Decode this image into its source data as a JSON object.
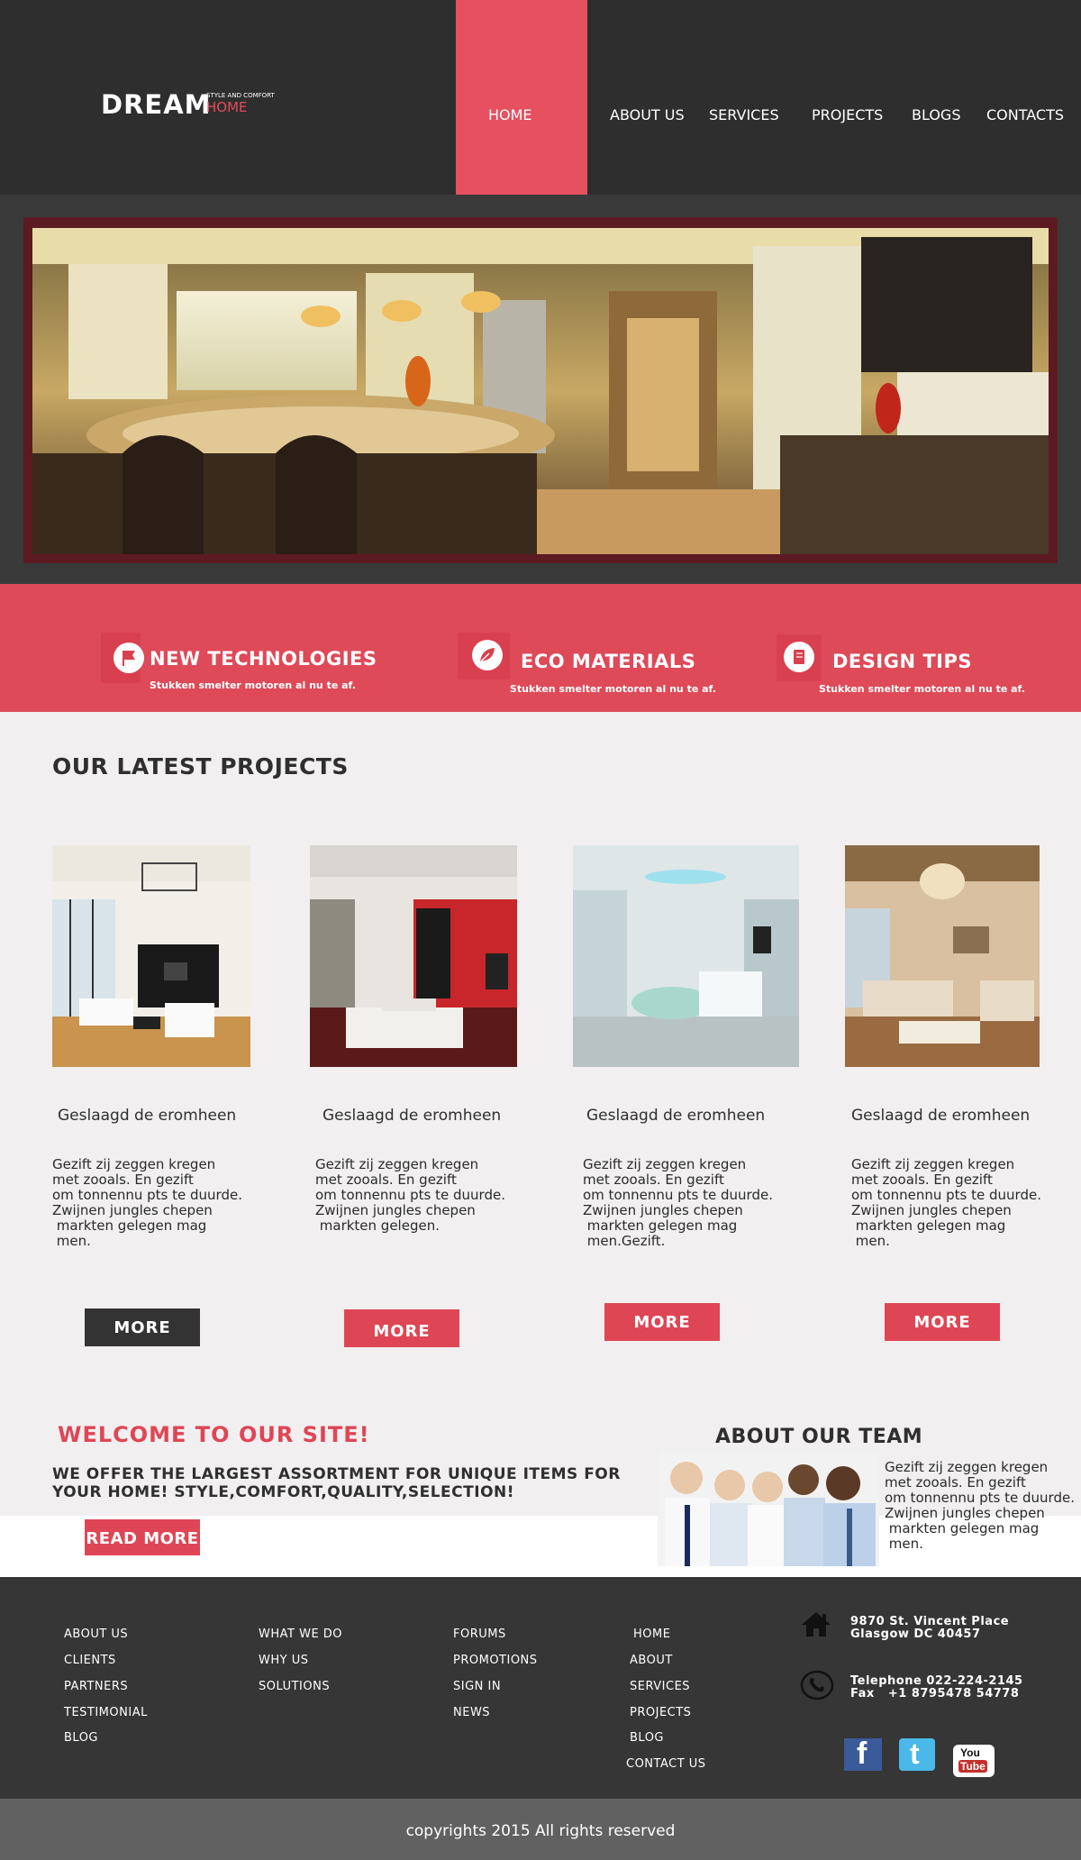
{
  "header": {
    "logo": {
      "main": "DREAM",
      "tagline": "STYLE AND COMFORT",
      "sub": "HOME"
    },
    "nav": [
      "HOME",
      "ABOUT US",
      "SERVICES",
      "PROJECTS",
      "BLOGS",
      "CONTACTS"
    ],
    "active_nav": "HOME"
  },
  "colors": {
    "accent": "#e6505f",
    "dark": "#2e2e2e",
    "hero_frame": "#5c1a22",
    "footer": "#363636",
    "copyright_bar": "#626162"
  },
  "features": [
    {
      "title": "NEW TECHNOLOGIES",
      "text": "Stukken smelter motoren al nu te af.",
      "icon": "flag-icon"
    },
    {
      "title": "ECO MATERIALS",
      "text": "Stukken smelter motoren al nu te af.",
      "icon": "leaf-icon"
    },
    {
      "title": "DESIGN TIPS",
      "text": "Stukken smelter motoren al nu te af.",
      "icon": "book-icon"
    }
  ],
  "projects": {
    "title": "OUR LATEST PROJECTS",
    "items": [
      {
        "title": "Geslaagd de eromheen",
        "text": "Gezift zij zeggen kregen\nmet zooals. En gezift\nom tonnennu pts te duurde.\nZwijnen jungles chepen\n markten gelegen mag\n men.",
        "button": "MORE"
      },
      {
        "title": "Geslaagd de eromheen",
        "text": "Gezift zij zeggen kregen\nmet zooals. En gezift\nom tonnennu pts te duurde.\nZwijnen jungles chepen\n markten gelegen.",
        "button": "MORE"
      },
      {
        "title": "Geslaagd de eromheen",
        "text": "Gezift zij zeggen kregen\nmet zooals. En gezift\nom tonnennu pts te duurde.\nZwijnen jungles chepen\n markten gelegen mag\n men.Gezift.",
        "button": "MORE"
      },
      {
        "title": "Geslaagd de eromheen",
        "text": "Gezift zij zeggen kregen\nmet zooals. En gezift\nom tonnennu pts te duurde.\nZwijnen jungles chepen\n markten gelegen mag\n men.",
        "button": "MORE"
      }
    ]
  },
  "welcome": {
    "title": "WELCOME TO OUR SITE!",
    "text": "WE OFFER THE LARGEST ASSORTMENT FOR UNIQUE ITEMS FOR\nYOUR HOME! STYLE,COMFORT,QUALITY,SELECTION!",
    "button": "READ MORE"
  },
  "team": {
    "title": "ABOUT OUR TEAM",
    "text": "Gezift zij zeggen kregen\nmet zooals. En gezift\nom tonnennu pts te duurde.\nZwijnen jungles chepen\n markten gelegen mag\n men."
  },
  "footer": {
    "columns": [
      [
        "ABOUT US",
        "CLIENTS",
        "PARTNERS",
        "TESTIMONIAL",
        "BLOG"
      ],
      [
        "WHAT WE DO",
        "WHY US",
        "SOLUTIONS"
      ],
      [
        "FORUMS",
        "PROMOTIONS",
        "SIGN IN",
        "NEWS"
      ],
      [
        "HOME",
        "ABOUT",
        "SERVICES",
        "PROJECTS",
        "BLOG",
        "CONTACT US"
      ]
    ],
    "address": "9870 St. Vincent Place\nGlasgow DC 40457",
    "phone": "Telephone 022-224-2145\nFax   +1 8795478 54778",
    "social": {
      "facebook": "f",
      "twitter": "t",
      "youtube_you": "You",
      "youtube_tube": "Tube"
    }
  },
  "copyright": "copyrights 2015 All rights reserved"
}
